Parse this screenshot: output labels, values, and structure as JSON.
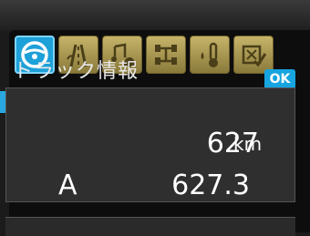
{
  "tabs": [
    {
      "icon": "steering-wheel-icon",
      "active": true
    },
    {
      "icon": "road-lane-icon",
      "active": false
    },
    {
      "icon": "music-bell-icon",
      "active": false
    },
    {
      "icon": "vehicle-axle-icon",
      "active": false
    },
    {
      "icon": "temperature-icon",
      "active": false
    },
    {
      "icon": "settings-check-icon",
      "active": false
    }
  ],
  "screen": {
    "title": "トラック情報",
    "ok_label": "OK"
  },
  "odometer": {
    "value": "627",
    "unit": "km"
  },
  "trip": {
    "label": "A",
    "value": "627.3"
  },
  "colors": {
    "accent": "#1ea0d8",
    "tab": "#b8a65c",
    "panel": "#2f2f2f"
  }
}
